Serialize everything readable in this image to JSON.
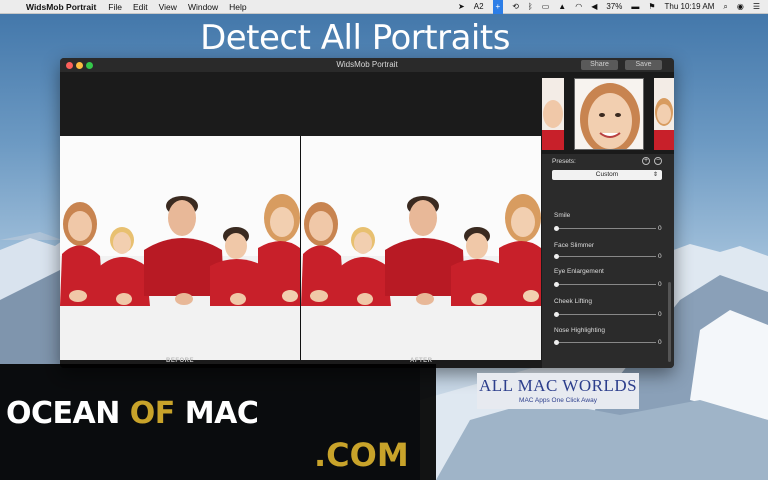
{
  "menubar": {
    "app_name": "WidsMob Portrait",
    "items": [
      "File",
      "Edit",
      "View",
      "Window",
      "Help"
    ],
    "status": {
      "adobe_badge": "2",
      "battery": "37%",
      "clock": "Thu 10:19 AM"
    }
  },
  "headline": "Detect All Portraits",
  "window": {
    "title": "WidsMob Portrait",
    "share_label": "Share",
    "save_label": "Save",
    "before_label": "BEFORE",
    "after_label": "AFTER"
  },
  "panel": {
    "presets_label": "Presets:",
    "add_symbol": "+",
    "remove_symbol": "−",
    "preset_value": "Custom",
    "sliders": [
      {
        "label": "Smile",
        "value": "0"
      },
      {
        "label": "Face Slimmer",
        "value": "0"
      },
      {
        "label": "Eye Enlargement",
        "value": "0"
      },
      {
        "label": "Cheek Lifting",
        "value": "0"
      },
      {
        "label": "Nose Highlighting",
        "value": "0"
      }
    ]
  },
  "watermarks": {
    "ocean_word1": "OCEAN",
    "ocean_word2": "OF",
    "ocean_word3": "MAC",
    "dotcom": ".COM",
    "allmac_title": "ALL MAC WORLDS",
    "allmac_sub": "MAC Apps One Click Away"
  },
  "colors": {
    "accent_blue": "#2d7ee7",
    "shirt_red": "#c8202a",
    "gold": "#c8a32a",
    "allmac_navy": "#2c3e8c"
  }
}
